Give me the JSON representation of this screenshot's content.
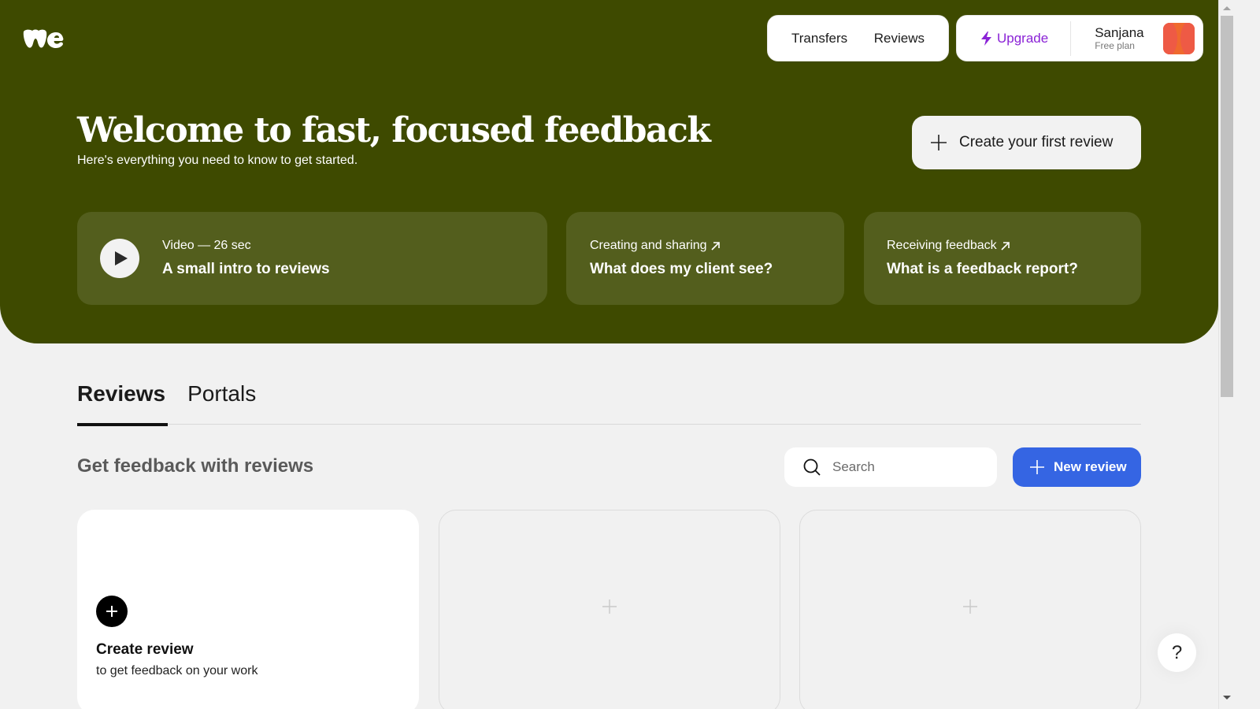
{
  "header": {
    "logo_alt": "we",
    "nav": [
      {
        "label": "Transfers"
      },
      {
        "label": "Reviews"
      }
    ],
    "upgrade_label": "Upgrade",
    "user": {
      "name": "Sanjana",
      "plan": "Free plan"
    }
  },
  "hero": {
    "title": "Welcome to fast, focused feedback",
    "subtitle": "Here's everything you need to know to get started.",
    "create_first_label": "Create your first review",
    "cards": [
      {
        "kicker": "Video — 26 sec",
        "headline": "A small intro to reviews",
        "icon": "play-icon"
      },
      {
        "kicker": "Creating and sharing",
        "headline": "What does my client see?",
        "icon": "arrow-up-right-icon"
      },
      {
        "kicker": "Receiving feedback",
        "headline": "What is a feedback report?",
        "icon": "arrow-up-right-icon"
      }
    ]
  },
  "tabs": [
    {
      "label": "Reviews",
      "active": true
    },
    {
      "label": "Portals",
      "active": false
    }
  ],
  "section": {
    "title": "Get feedback with reviews",
    "search_placeholder": "Search",
    "new_review_label": "New review"
  },
  "review_cards": {
    "create": {
      "title": "Create review",
      "subtitle": "to get feedback on your work"
    }
  },
  "help_label": "?",
  "colors": {
    "hero_bg": "#3e4a00",
    "card_bg": "#535e1d",
    "upgrade": "#8a22d6",
    "primary": "#3565e3",
    "page_bg": "#f1f1f1"
  }
}
